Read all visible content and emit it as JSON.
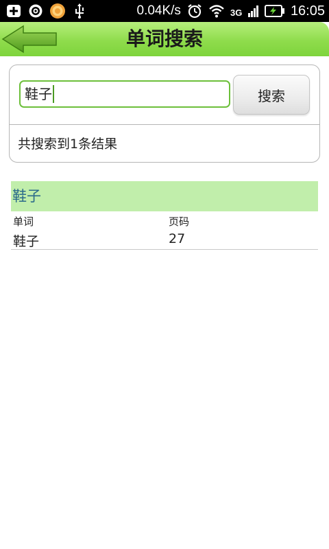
{
  "status_bar": {
    "net_speed": "0.04K/s",
    "network_type": "3G",
    "time": "16:05",
    "icons": [
      "add-icon",
      "at-icon",
      "coin-icon",
      "usb-icon",
      "alarm-icon",
      "wifi-icon",
      "signal-icon",
      "battery-charging-icon"
    ]
  },
  "header": {
    "title": "单词搜索",
    "back_icon": "arrow-left-icon",
    "accent_color": "#8fdc4c"
  },
  "search": {
    "value": "鞋子",
    "button_label": "搜索",
    "result_summary": "共搜索到1条结果"
  },
  "results": {
    "group_title": "鞋子",
    "columns": [
      "单词",
      "页码"
    ],
    "rows": [
      {
        "word": "鞋子",
        "page": "27"
      }
    ]
  }
}
